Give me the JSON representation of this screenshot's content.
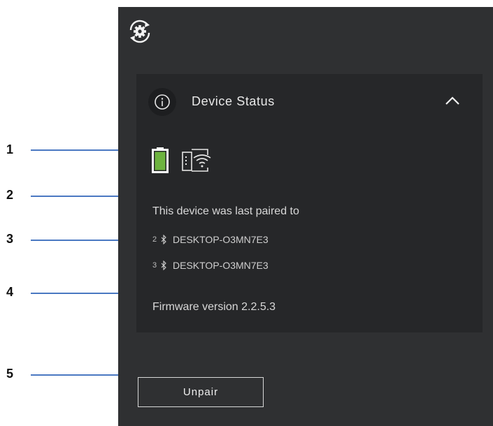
{
  "card": {
    "title": "Device Status",
    "paired_text": "This device was last paired to",
    "devices": [
      {
        "slot": "2",
        "name": "DESKTOP-O3MN7E3"
      },
      {
        "slot": "3",
        "name": "DESKTOP-O3MN7E3"
      }
    ],
    "firmware_text": "Firmware version 2.2.5.3"
  },
  "unpair_label": "Unpair",
  "callouts": [
    "1",
    "2",
    "3",
    "4",
    "5"
  ],
  "colors": {
    "panel": "#2f3032",
    "card": "#262729",
    "battery_fill": "#6db33f",
    "callout_line": "#4a78c2"
  },
  "icons": [
    "settings-sync-icon",
    "info-icon",
    "chevron-up-icon",
    "battery-full-icon",
    "wireless-receiver-icon",
    "bluetooth-icon"
  ]
}
